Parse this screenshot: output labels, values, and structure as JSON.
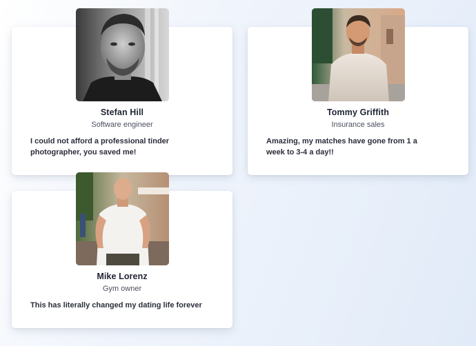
{
  "testimonials": [
    {
      "name": "Stefan Hill",
      "role": "Software engineer",
      "quote": "I could not afford a professional tinder photographer, you saved me!"
    },
    {
      "name": "Tommy Griffith",
      "role": "Insurance sales",
      "quote": "Amazing, my matches have gone from 1 a week to 3-4 a day!!"
    },
    {
      "name": "Mike Lorenz",
      "role": "Gym owner",
      "quote": "This has literally changed my dating life forever"
    }
  ]
}
